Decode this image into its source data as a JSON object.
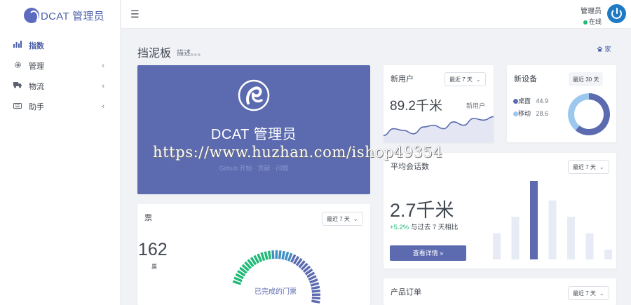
{
  "brand": {
    "name": "DCAT 管理员",
    "color": "#4a5ea8"
  },
  "sidebar": {
    "items": [
      {
        "icon": "bar-chart-icon",
        "label": "指数",
        "active": true,
        "has_children": false
      },
      {
        "icon": "gear-icon",
        "label": "管理",
        "active": false,
        "has_children": true
      },
      {
        "icon": "truck-icon",
        "label": "物流",
        "active": false,
        "has_children": true
      },
      {
        "icon": "keyboard-icon",
        "label": "助手",
        "active": false,
        "has_children": true
      }
    ],
    "chevron": "‹"
  },
  "topbar": {
    "menu_icon": "☰",
    "user_name": "管理员",
    "user_status": "在线",
    "status_color": "#21b978"
  },
  "header": {
    "title": "挡泥板",
    "description": "描述。。。",
    "breadcrumb": "家"
  },
  "banner": {
    "title": "DCAT 管理员",
    "subtitle": "Github 开始 · 贡献 · 问题",
    "background": "#5c6bb0"
  },
  "watermark": "https://www.huzhan.com/ishop49354",
  "new_users": {
    "title": "新用户",
    "filter": "最近 7 天",
    "value": "89.2千米",
    "series_label": "新用户",
    "chart_data": {
      "type": "area",
      "values": [
        2,
        4,
        3.5,
        2.5,
        4.5,
        5,
        4,
        6,
        5,
        7,
        6.5,
        7.5
      ]
    }
  },
  "new_devices": {
    "title": "新设备",
    "filter": "最近 30 天",
    "legend": [
      {
        "name": "桌面",
        "value": "44.9",
        "color": "#5c6bb0"
      },
      {
        "name": "移动",
        "value": "28.6",
        "color": "#9cc8f0"
      }
    ],
    "chart_data": {
      "type": "pie",
      "categories": [
        "桌面",
        "移动"
      ],
      "values": [
        44.9,
        28.6
      ]
    }
  },
  "avg_sessions": {
    "title": "平均会话数",
    "filter": "最近 7 天",
    "value": "2.7千米",
    "change": "+5.2%",
    "change_text": "与过去 7 天相比",
    "button": "查看详情 »",
    "chart_data": {
      "type": "bar",
      "values": [
        40,
        65,
        120,
        90,
        65,
        40,
        15
      ]
    }
  },
  "tickets": {
    "title": "票",
    "filter": "最近 7 天",
    "value": "162",
    "unit": "票",
    "gauge_label": "已完成的门票"
  },
  "product_orders": {
    "title": "产品订单",
    "filter": "最近 7 天"
  }
}
